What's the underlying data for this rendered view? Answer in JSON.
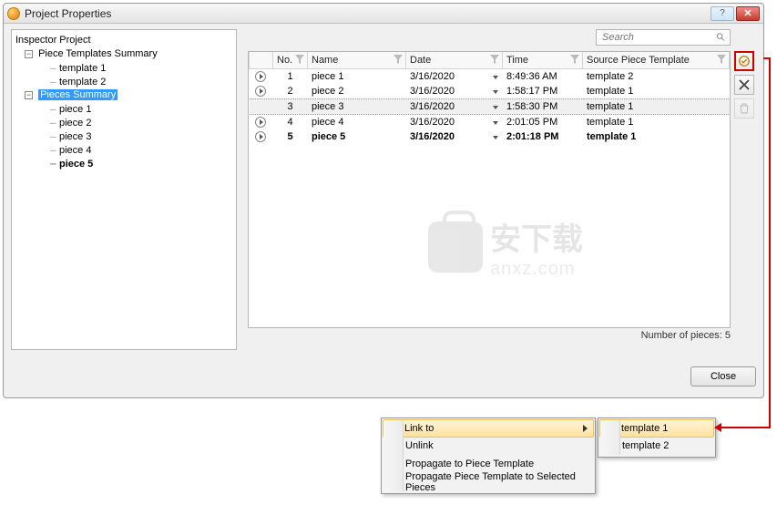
{
  "window": {
    "title": "Project Properties"
  },
  "search": {
    "placeholder": "Search"
  },
  "tree": {
    "root": "Inspector Project",
    "node1": "Piece Templates Summary",
    "node1_children": [
      "template 1",
      "template 2"
    ],
    "node2": "Pieces Summary",
    "node2_children": [
      "piece 1",
      "piece 2",
      "piece 3",
      "piece 4",
      "piece 5"
    ]
  },
  "columns": {
    "no": "No.",
    "name": "Name",
    "date": "Date",
    "time": "Time",
    "source": "Source Piece Template"
  },
  "rows": [
    {
      "no": "1",
      "name": "piece 1",
      "date": "3/16/2020",
      "time": "8:49:36 AM",
      "source": "template 2",
      "playable": true,
      "selected": false,
      "bold": false
    },
    {
      "no": "2",
      "name": "piece 2",
      "date": "3/16/2020",
      "time": "1:58:17 PM",
      "source": "template 1",
      "playable": true,
      "selected": false,
      "bold": false
    },
    {
      "no": "3",
      "name": "piece 3",
      "date": "3/16/2020",
      "time": "1:58:30 PM",
      "source": "template 1",
      "playable": false,
      "selected": true,
      "bold": false
    },
    {
      "no": "4",
      "name": "piece 4",
      "date": "3/16/2020",
      "time": "2:01:05 PM",
      "source": "template 1",
      "playable": true,
      "selected": false,
      "bold": false
    },
    {
      "no": "5",
      "name": "piece 5",
      "date": "3/16/2020",
      "time": "2:01:18 PM",
      "source": "template 1",
      "playable": true,
      "selected": false,
      "bold": true
    }
  ],
  "status": "Number of pieces:  5",
  "close_label": "Close",
  "context_menu": {
    "link_to": "Link to",
    "unlink": "Unlink",
    "propagate": "Propagate to Piece Template",
    "propagate_selected": "Propagate Piece Template to Selected Pieces"
  },
  "submenu": [
    "template 1",
    "template 2"
  ],
  "watermark": {
    "cn": "安下载",
    "en": "anxz.com"
  }
}
